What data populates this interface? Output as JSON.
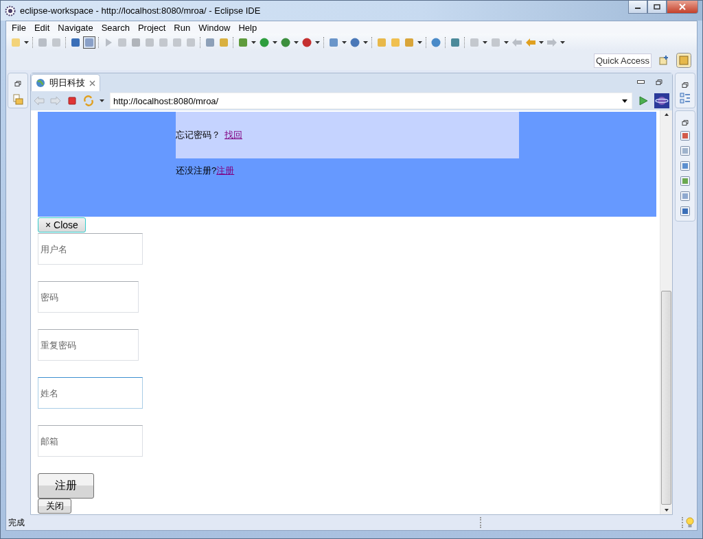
{
  "window": {
    "title": "eclipse-workspace - http://localhost:8080/mroa/ - Eclipse IDE"
  },
  "menu": [
    "File",
    "Edit",
    "Navigate",
    "Search",
    "Project",
    "Run",
    "Window",
    "Help"
  ],
  "quick_access": {
    "placeholder": "Quick Access"
  },
  "editor_tab": {
    "label": "明日科技",
    "selected": true
  },
  "browser": {
    "url": "http://localhost:8080/mroa/"
  },
  "page": {
    "forgot_text": "忘记密码？",
    "forgot_link": "找回",
    "register_text": "还没注册?",
    "register_link": "注册",
    "close_button": "× Close",
    "fields": [
      {
        "placeholder": "用户名",
        "focused": false,
        "wide": true
      },
      {
        "placeholder": "密码",
        "focused": false,
        "wide": false
      },
      {
        "placeholder": "重复密码",
        "focused": false,
        "wide": false
      },
      {
        "placeholder": "姓名",
        "focused": true,
        "wide": true
      },
      {
        "placeholder": "邮箱",
        "focused": false,
        "wide": true
      }
    ],
    "submit_button": "注册",
    "cancel_button": "关闭"
  },
  "status_bar": {
    "text": "完成"
  }
}
